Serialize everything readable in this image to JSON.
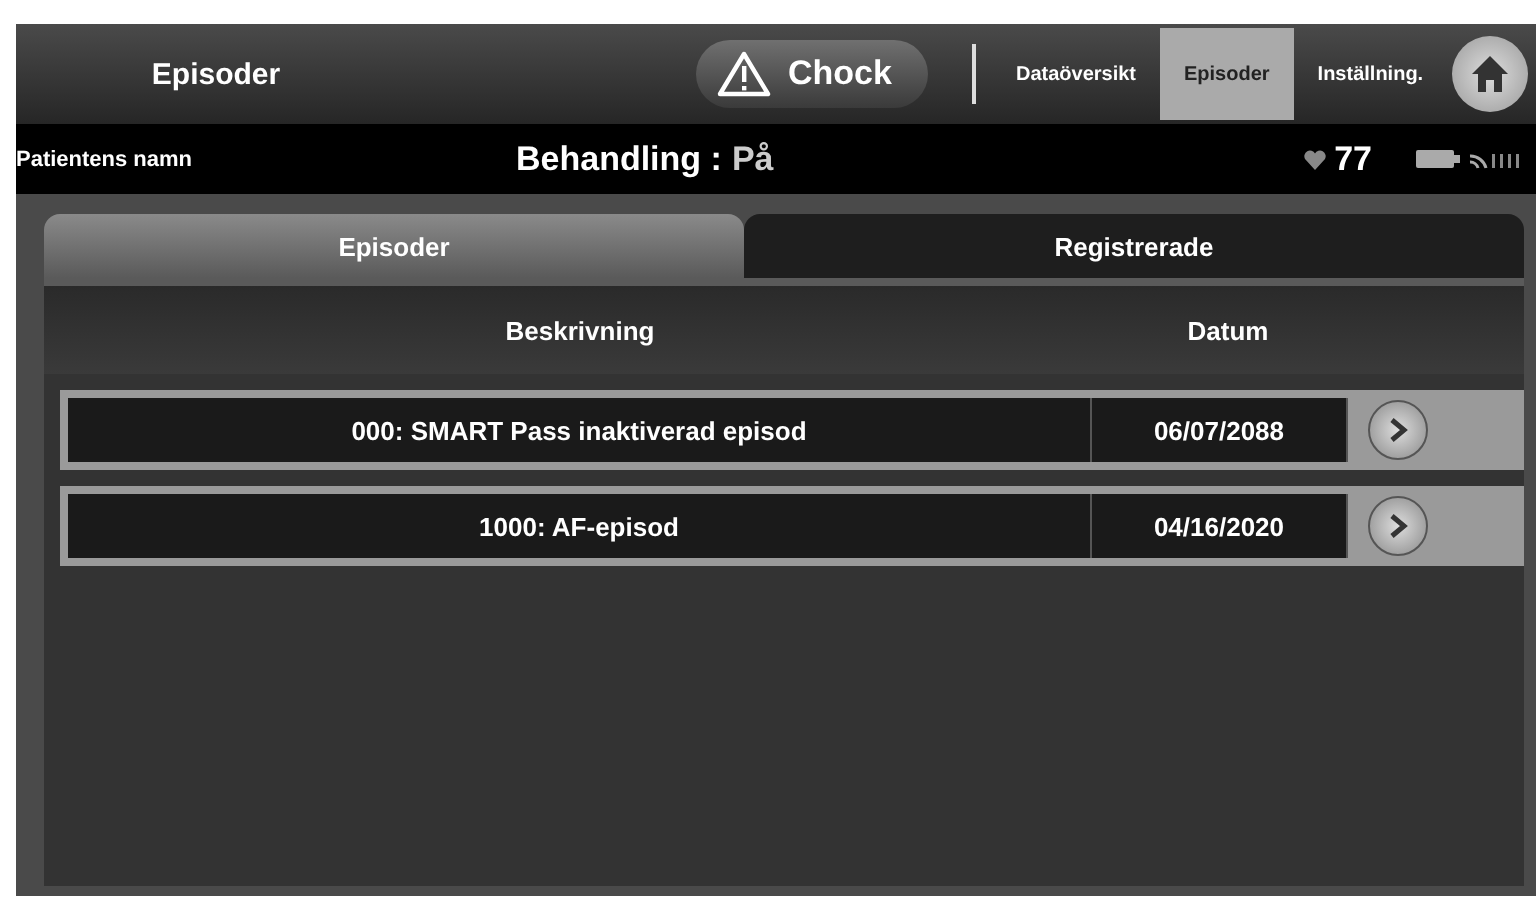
{
  "header": {
    "title": "Episoder",
    "shock_button": "Chock",
    "nav": [
      {
        "label": "Dataöversikt",
        "selected": false
      },
      {
        "label": "Episoder",
        "selected": true
      },
      {
        "label": "Inställning.",
        "selected": false
      }
    ]
  },
  "status_bar": {
    "patient": "Patientens namn",
    "therapy_label": "Behandling :",
    "therapy_value": "På",
    "heart_rate": "77"
  },
  "tabs": [
    {
      "label": "Episoder",
      "selected": true
    },
    {
      "label": "Registrerade",
      "selected": false
    }
  ],
  "table": {
    "columns": [
      "Beskrivning",
      "Datum"
    ],
    "rows": [
      {
        "description": "000: SMART Pass inaktiverad episod",
        "date": "06/07/2088"
      },
      {
        "description": "1000: AF-episod",
        "date": "04/16/2020"
      }
    ]
  }
}
